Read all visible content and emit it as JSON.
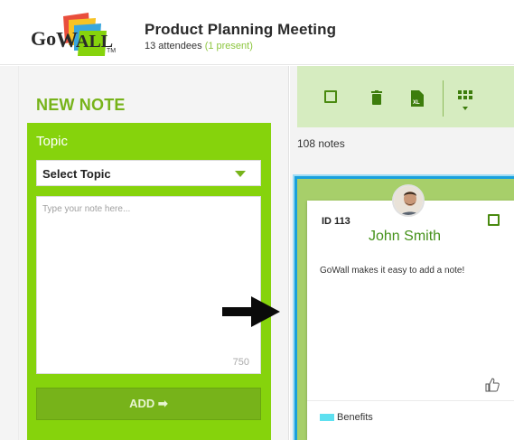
{
  "header": {
    "meeting_title": "Product Planning Meeting",
    "attendees_text": "13 attendees",
    "present_text": "(1 present)"
  },
  "left_panel": {
    "title": "NEW NOTE",
    "topic_label": "Topic",
    "select_topic": "Select Topic",
    "note_placeholder": "Type your note here...",
    "char_count": "750",
    "add_button": "ADD ➡"
  },
  "right_panel": {
    "notes_count": "108 notes",
    "toolbar": {
      "icons": [
        "checkbox-icon",
        "trash-icon",
        "excel-export-icon",
        "grid-view-icon"
      ]
    }
  },
  "card": {
    "id_text": "ID 113",
    "name": "John Smith",
    "body": "GoWall makes it easy to add a note!",
    "tag": "Benefits",
    "tag_color": "#5ee0f0"
  },
  "colors": {
    "brand_green": "#86d30c",
    "dark_green": "#77b31a",
    "highlight_blue": "#1aa0dc"
  }
}
